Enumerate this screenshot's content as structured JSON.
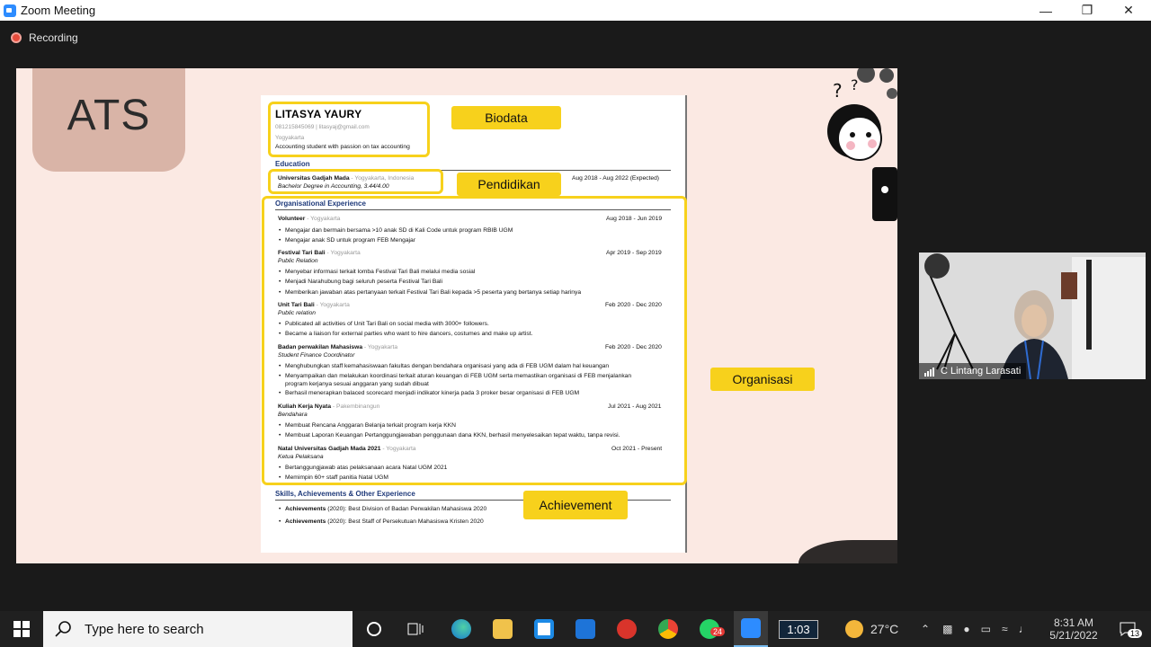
{
  "window": {
    "title": "Zoom Meeting"
  },
  "recording": {
    "label": "Recording"
  },
  "slide": {
    "title_block": "ATS",
    "tags": {
      "biodata": "Biodata",
      "pendidikan": "Pendidikan",
      "organisasi": "Organisasi",
      "achievement": "Achievement"
    },
    "cv": {
      "name": "LITASYA YAURY",
      "contact": "081215845069 | litasyaj@gmail.com",
      "city": "Yogyakarta",
      "summary": "Accounting student with passion on tax accounting",
      "education_heading": "Education",
      "edu_school": "Universitas Gadjah Mada",
      "edu_location": " - Yogyakarta, Indonesia",
      "edu_degree": "Bachelor Degree in Accounting, 3.44/4.00",
      "edu_dates": "Aug 2018 - Aug 2022 (Expected)",
      "org_heading": "Organisational Experience",
      "orgs": [
        {
          "title": "Volunteer",
          "loc": " - Yogyakarta",
          "role": "",
          "dates": "Aug 2018 - Jun 2019",
          "bullets": [
            "Mengajar dan bermain bersama >10 anak  SD di Kali Code untuk program RBIB UGM",
            "Mengajar anak SD untuk program FEB Mengajar"
          ]
        },
        {
          "title": "Festival Tari Bali",
          "loc": " - Yogyakarta",
          "role": "Public Relation",
          "dates": "Apr 2019 - Sep 2019",
          "bullets": [
            "Menyebar informasi terkait lomba Festival Tari Bali melalui media sosial",
            "Menjadi Narahubung bagi seluruh peserta Festival Tari Bali",
            "Memberikan jawaban atas pertanyaan terkait Festival Tari Bali kepada >5 peserta yang bertanya setiap harinya"
          ]
        },
        {
          "title": "Unit Tari Bali",
          "loc": " - Yogyakarta",
          "role": "Public relation",
          "dates": "Feb 2020 - Dec 2020",
          "bullets": [
            "Publicated all activities of Unit Tari Bali on social media with 3000+ followers.",
            "Became a liaison for external parties who want to  hire dancers, costumes and make up artist."
          ]
        },
        {
          "title": "Badan perwakilan Mahasiswa",
          "loc": " - Yogyakarta",
          "role": "Student Finance Coordinator",
          "dates": "Feb 2020 - Dec 2020",
          "bullets": [
            "Menghubungkan staff kemahasiswaan fakultas dengan bendahara organisasi yang ada di FEB UGM dalam hal keuangan",
            "Menyampaikan dan melakukan koordinasi terkait aturan keuangan di FEB UGM serta memastikan organisasi di FEB menjalankan",
            "program kerjanya sesuai anggaran yang sudah dibuat",
            "Berhasil menerapkan balaced scorecard menjadi indikator kinerja pada 3 proker besar organisasi di FEB UGM"
          ]
        },
        {
          "title": "Kuliah Kerja Nyata",
          "loc": " - Pakembinangun",
          "role": "Bendahara",
          "dates": "Jul 2021 - Aug 2021",
          "bullets": [
            "Membuat Rencana Anggaran Belanja terkait program kerja KKN",
            "Membuat Laporan Keuangan Pertanggungjawaban penggunaan dana KKN, berhasil menyelesaikan tepat waktu, tanpa revisi."
          ]
        },
        {
          "title": "Natal Universitas Gadjah Mada 2021",
          "loc": " - Yogyakarta",
          "role": "Ketua Pelaksana",
          "dates": "Oct 2021 - Present",
          "bullets": [
            "Bertanggungjawab atas pelaksanaan acara Natal UGM 2021",
            "Memimpin 60+ staff panitia Natal UGM"
          ]
        }
      ],
      "skills_heading": "Skills, Achievements & Other Experience",
      "achievements": [
        {
          "label": "Achievements",
          "text": " (2020): Best Division of Badan Perwakilan Mahasiswa 2020"
        },
        {
          "label": "Achievements",
          "text": " (2020): Best Staff of Persekutuan Mahasiswa Kristen 2020"
        }
      ]
    }
  },
  "video": {
    "participant": "C Lintang Larasati"
  },
  "taskbar": {
    "search_placeholder": "Type here to search",
    "timer": "1:03",
    "whatsapp_badge": "24",
    "weather": "27°C",
    "time": "8:31 AM",
    "date": "5/21/2022",
    "notif_count": "13"
  },
  "colors": {
    "highlight": "#f7d11c",
    "slide_bg": "#fbe9e3",
    "ats_block": "#d9b4a7"
  }
}
